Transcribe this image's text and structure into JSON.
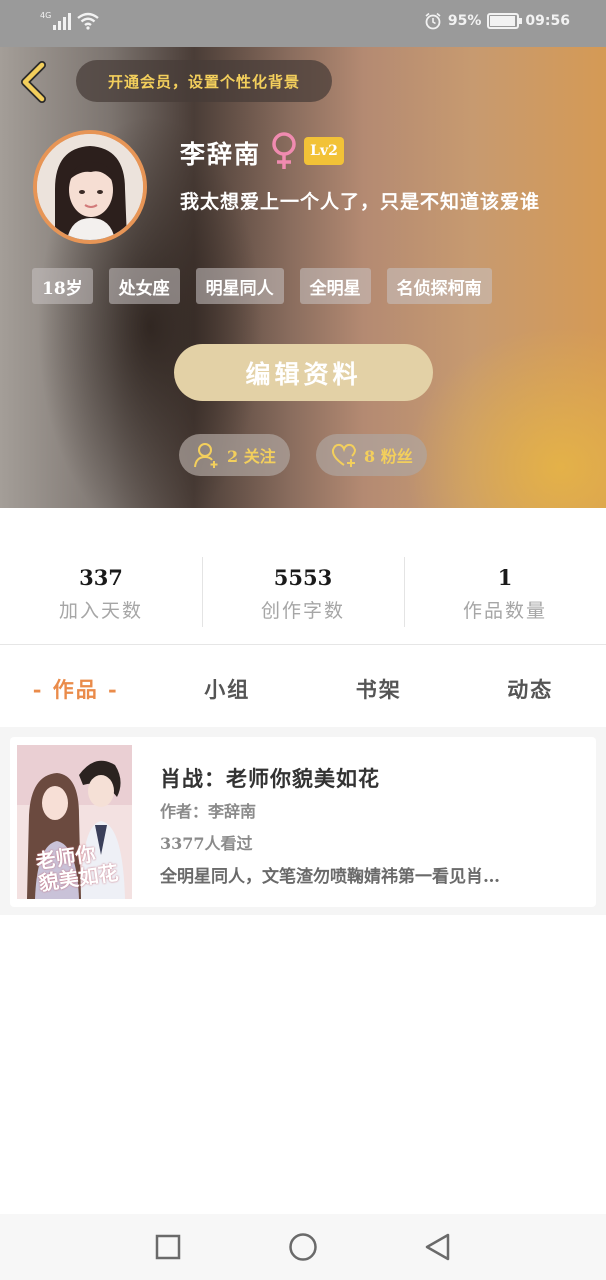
{
  "status_bar": {
    "network": "4G",
    "battery": "95%",
    "time": "09:56"
  },
  "header": {
    "vip_banner": "开通会员，设置个性化背景",
    "username": "李辞南",
    "level": "Lv2",
    "signature": "我太想爱上一个人了，只是不知道该爱谁",
    "tags": [
      "18岁",
      "处女座",
      "明星同人",
      "全明星",
      "名侦探柯南"
    ],
    "edit_button": "编辑资料",
    "following": "2 关注",
    "fans": "8 粉丝"
  },
  "stats": [
    {
      "value": "337",
      "label": "加入天数"
    },
    {
      "value": "5553",
      "label": "创作字数"
    },
    {
      "value": "1",
      "label": "作品数量"
    }
  ],
  "tabs": [
    "作品",
    "小组",
    "书架",
    "动态"
  ],
  "works": [
    {
      "title": "肖战：老师你貌美如花",
      "author": "作者：李辞南",
      "views": "3377人看过",
      "description": "全明星同人，文笔渣勿喷鞠婧祎第一看见肖…",
      "cover_text_line1": "老师你",
      "cover_text_line2": "貌美如花"
    }
  ],
  "colors": {
    "accent": "#ea8b4a",
    "gold": "#f3cf5c",
    "edit_button": "#e3d1a6",
    "level_badge": "#f2c237"
  },
  "icons": {
    "back": "chevron-left-icon",
    "gender": "female-icon",
    "follow": "user-plus-icon",
    "fans": "heart-plus-icon",
    "nav": [
      "square-icon",
      "circle-icon",
      "triangle-back-icon"
    ]
  }
}
